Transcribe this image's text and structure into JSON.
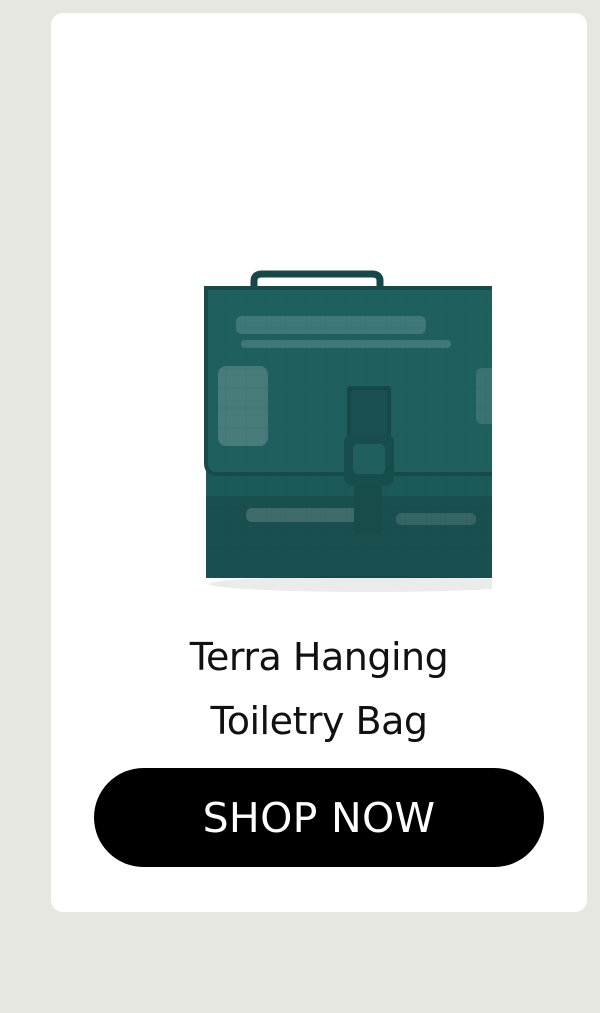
{
  "product": {
    "title_line1": "Terra Hanging",
    "title_line2": "Toiletry Bag",
    "image_alt": "Terra Hanging Toiletry Bag in teal",
    "color": "#1c5a59"
  },
  "cta": {
    "label": "SHOP NOW"
  }
}
